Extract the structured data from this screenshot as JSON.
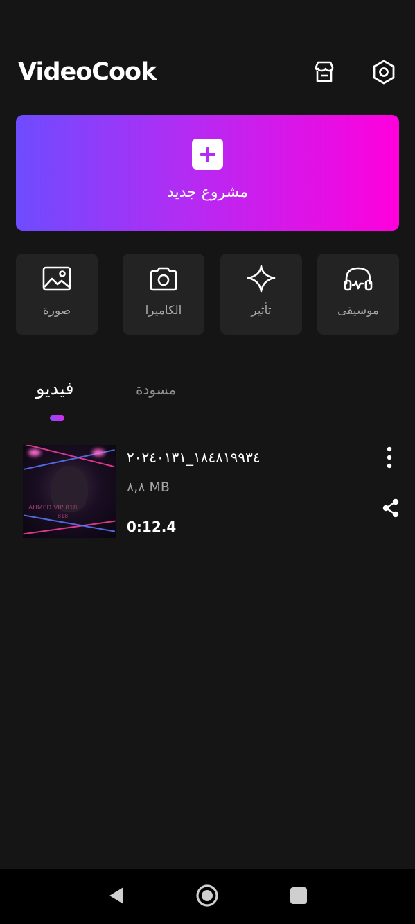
{
  "app": {
    "logo_text": "VideoCook"
  },
  "header": {
    "store_icon": "store-icon",
    "settings_icon": "settings-hexagon-icon"
  },
  "new_project": {
    "label": "مشروع جديد",
    "icon": "plus-icon",
    "gradient": [
      "#6e4cff",
      "#ff00dc"
    ]
  },
  "tools": [
    {
      "label": "موسيقى",
      "icon": "headphones-icon"
    },
    {
      "label": "تأثير",
      "icon": "sparkle-icon"
    },
    {
      "label": "الكاميرا",
      "icon": "camera-icon"
    },
    {
      "label": "صورة",
      "icon": "image-icon"
    }
  ],
  "tabs": [
    {
      "label": "فيديو",
      "active": true
    },
    {
      "label": "مسودة",
      "active": false
    }
  ],
  "videos": [
    {
      "name": "١٨٤٨١٩٩٣٤_٢٠٢٤٠١٣١",
      "size": "٨,٨ MB",
      "duration": "0:12.4",
      "thumb_caption": "AHMED VIP 818",
      "thumb_caption2": "818"
    }
  ],
  "navbar": {
    "back_icon": "back-triangle-icon",
    "home_icon": "home-circle-icon",
    "recents_icon": "recents-square-icon"
  },
  "colors": {
    "background": "#151515",
    "card": "#232324",
    "accent": "#b42bf3"
  }
}
